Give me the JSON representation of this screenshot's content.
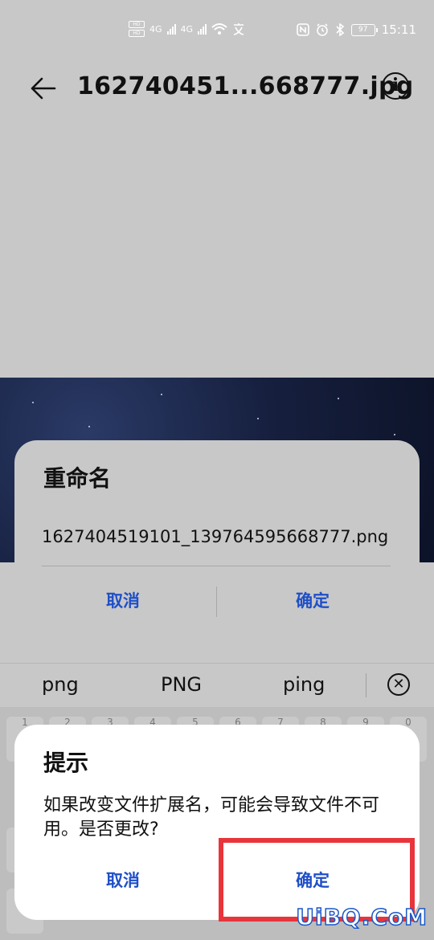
{
  "status_bar": {
    "hd_top": "HD",
    "hd_bottom": "HD",
    "net1": "4G",
    "net2": "4G",
    "battery": "97",
    "time": "15:11"
  },
  "header": {
    "file_name": "162740451...668777.jpg"
  },
  "rename_dialog": {
    "title": "重命名",
    "input_value": "1627404519101_139764595668777.png",
    "cancel_label": "取消",
    "confirm_label": "确定"
  },
  "suggestions": {
    "items": [
      "png",
      "PNG",
      "ping"
    ]
  },
  "keyboard": {
    "number_keys": [
      "1",
      "2",
      "3",
      "4",
      "5",
      "6",
      "7",
      "8",
      "9",
      "0"
    ]
  },
  "prompt_dialog": {
    "title": "提示",
    "message": "如果改变文件扩展名，可能会导致文件不可用。是否更改?",
    "cancel_label": "取消",
    "confirm_label": "确定"
  },
  "watermark": {
    "text": "UiBQ.CoM"
  },
  "colors": {
    "accent": "#1f4fc7",
    "highlight": "#e8353b"
  }
}
